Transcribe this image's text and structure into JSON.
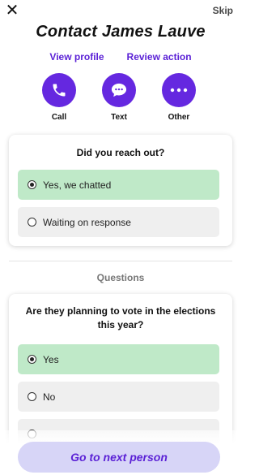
{
  "header": {
    "close_icon": "close-icon",
    "skip_label": "Skip",
    "title": "Contact James Lauve"
  },
  "links": {
    "view_profile": "View profile",
    "review_action": "Review action"
  },
  "actions": [
    {
      "label": "Call",
      "icon": "phone-icon"
    },
    {
      "label": "Text",
      "icon": "chat-bubble-icon"
    },
    {
      "label": "Other",
      "icon": "more-dots-icon"
    }
  ],
  "reach_out": {
    "question": "Did you reach out?",
    "options": [
      {
        "label": "Yes, we chatted",
        "selected": true
      },
      {
        "label": "Waiting on response",
        "selected": false
      }
    ]
  },
  "questions_section": {
    "title": "Questions"
  },
  "vote_question": {
    "question": "Are they planning to vote in the elections this year?",
    "options": [
      {
        "label": "Yes",
        "selected": true
      },
      {
        "label": "No",
        "selected": false
      }
    ]
  },
  "footer": {
    "next_label": "Go to next person"
  },
  "colors": {
    "accent": "#6528e0",
    "selected_bg": "#bfe9c8",
    "option_bg": "#efefef",
    "next_bg": "#d7d5f7"
  }
}
